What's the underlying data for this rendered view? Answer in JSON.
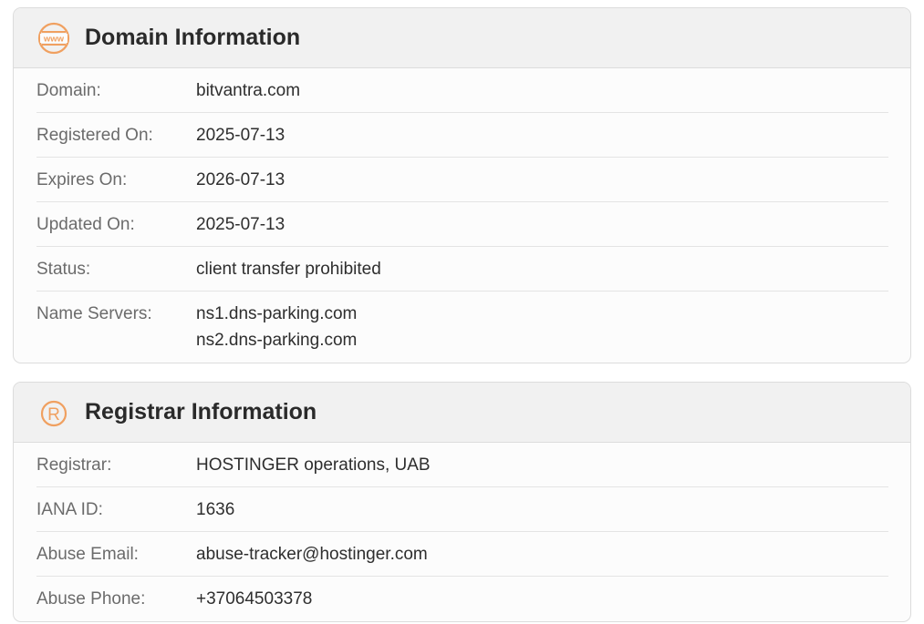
{
  "domain_card": {
    "title": "Domain Information",
    "icon": "www-globe-icon",
    "rows": [
      {
        "label": "Domain:",
        "value": "bitvantra.com"
      },
      {
        "label": "Registered On:",
        "value": "2025-07-13"
      },
      {
        "label": "Expires On:",
        "value": "2026-07-13"
      },
      {
        "label": "Updated On:",
        "value": "2025-07-13"
      },
      {
        "label": "Status:",
        "value": "client transfer prohibited"
      },
      {
        "label": "Name Servers:",
        "values": [
          "ns1.dns-parking.com",
          "ns2.dns-parking.com"
        ]
      }
    ]
  },
  "registrar_card": {
    "title": "Registrar Information",
    "icon": "registered-trademark-icon",
    "rows": [
      {
        "label": "Registrar:",
        "value": "HOSTINGER operations, UAB"
      },
      {
        "label": "IANA ID:",
        "value": "1636"
      },
      {
        "label": "Abuse Email:",
        "value": "abuse-tracker@hostinger.com"
      },
      {
        "label": "Abuse Phone:",
        "value": "+37064503378"
      }
    ]
  },
  "colors": {
    "accent": "#f0a060",
    "header_bg": "#f1f1f1",
    "border": "#dcdcdc"
  }
}
